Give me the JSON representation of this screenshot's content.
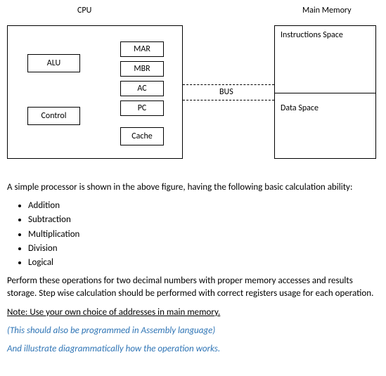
{
  "labels": {
    "cpu": "CPU",
    "main_memory": "Main Memory",
    "alu": "ALU",
    "control": "Control",
    "mar": "MAR",
    "mbr": "MBR",
    "ac": "AC",
    "pc": "PC",
    "cache": "Cache",
    "bus": "BUS",
    "instr_space": "Instructions Space",
    "data_space": "Data Space"
  },
  "text": {
    "intro": "A simple processor is shown in the above figure, having the following basic calculation ability:",
    "ops": [
      "Addition",
      "Subtraction",
      "Multiplication",
      "Division",
      "Logical"
    ],
    "task": "Perform these operations for two decimal numbers with proper memory accesses and results storage. Step wise calculation should be performed with correct registers usage for each operation.",
    "note": "Note: Use your own choice of addresses in main memory.",
    "hint1": "(This should also be programmed in Assembly language)",
    "hint2": "And illustrate diagrammatically how the operation works."
  }
}
